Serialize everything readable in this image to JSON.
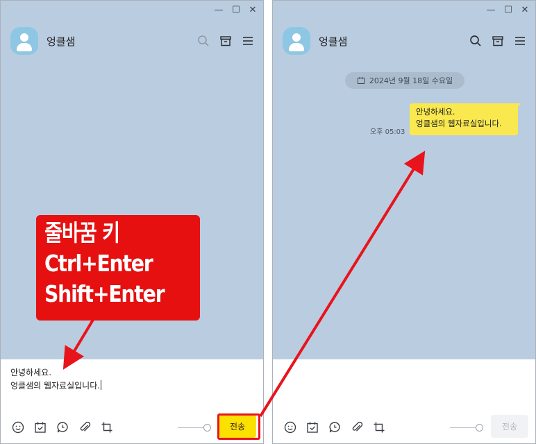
{
  "left_window": {
    "controls": {
      "minimize": "—",
      "maximize": "☐",
      "close": "✕"
    },
    "chat_name": "엉클샘",
    "input_lines": [
      "안녕하세요.",
      "엉클샘의 웹자료실입니다."
    ],
    "send_label": "전송"
  },
  "right_window": {
    "controls": {
      "minimize": "—",
      "maximize": "☐",
      "close": "✕"
    },
    "chat_name": "엉클샘",
    "date_label": "2024년 9월 18일 수요일",
    "message": {
      "time": "오후 05:03",
      "lines": [
        "안녕하세요.",
        "엉클샘의 웹자료실입니다."
      ]
    },
    "send_label": "전송"
  },
  "callout": {
    "lines": [
      "줄바꿈 키",
      "Ctrl+Enter",
      "Shift+Enter"
    ]
  },
  "icons": {
    "header": [
      "search-icon",
      "drawer-icon",
      "menu-icon"
    ],
    "toolbar": [
      "emoji-icon",
      "calendar-icon",
      "chat-bubble-icon",
      "attach-icon",
      "capture-icon"
    ]
  },
  "colors": {
    "chat_background": "#bacce0",
    "bubble": "#fae84f",
    "send_active": "#fae100",
    "annotation_red": "#e61010",
    "avatar": "#8ec7e3"
  }
}
